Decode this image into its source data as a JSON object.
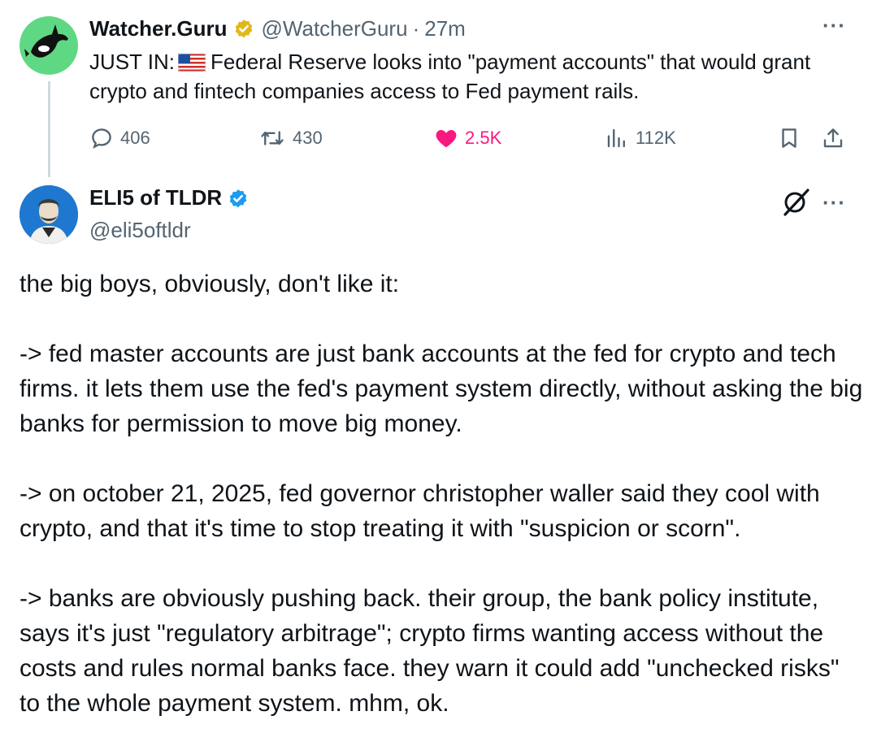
{
  "quoted": {
    "name": "Watcher.Guru",
    "handle": "@WatcherGuru",
    "separator": "·",
    "time": "27m",
    "text_prefix": "JUST IN:",
    "flag_icon": "us-flag-icon",
    "text_body": "Federal Reserve looks into \"payment accounts\" that would grant crypto and fintech companies access to Fed payment rails.",
    "more": "···",
    "stats": {
      "replies": "406",
      "reposts": "430",
      "likes": "2.5K",
      "views": "112K"
    },
    "colors": {
      "verified_gold": "#e2b719",
      "like": "#f91880",
      "avatar_bg": "#5fd884"
    }
  },
  "reply": {
    "name": "ELI5 of TLDR",
    "handle": "@eli5oftldr",
    "more": "···",
    "paragraphs": [
      "the big boys, obviously, don't like it:",
      "-> fed master accounts are just bank accounts at the fed for crypto and tech firms. it lets them use the fed's payment system directly, without asking the big banks for permission to move big money.",
      "-> on october 21, 2025, fed governor christopher waller said they cool with crypto, and that it's time to stop treating it with \"suspicion or scorn\".",
      "-> banks are obviously pushing back. their group, the bank policy institute, says it's just \"regulatory arbitrage\"; crypto firms wanting access without the costs and rules normal banks face. they warn it could add \"unchecked risks\" to the whole payment system. mhm, ok."
    ],
    "colors": {
      "verified_blue": "#1d9bf0"
    }
  }
}
